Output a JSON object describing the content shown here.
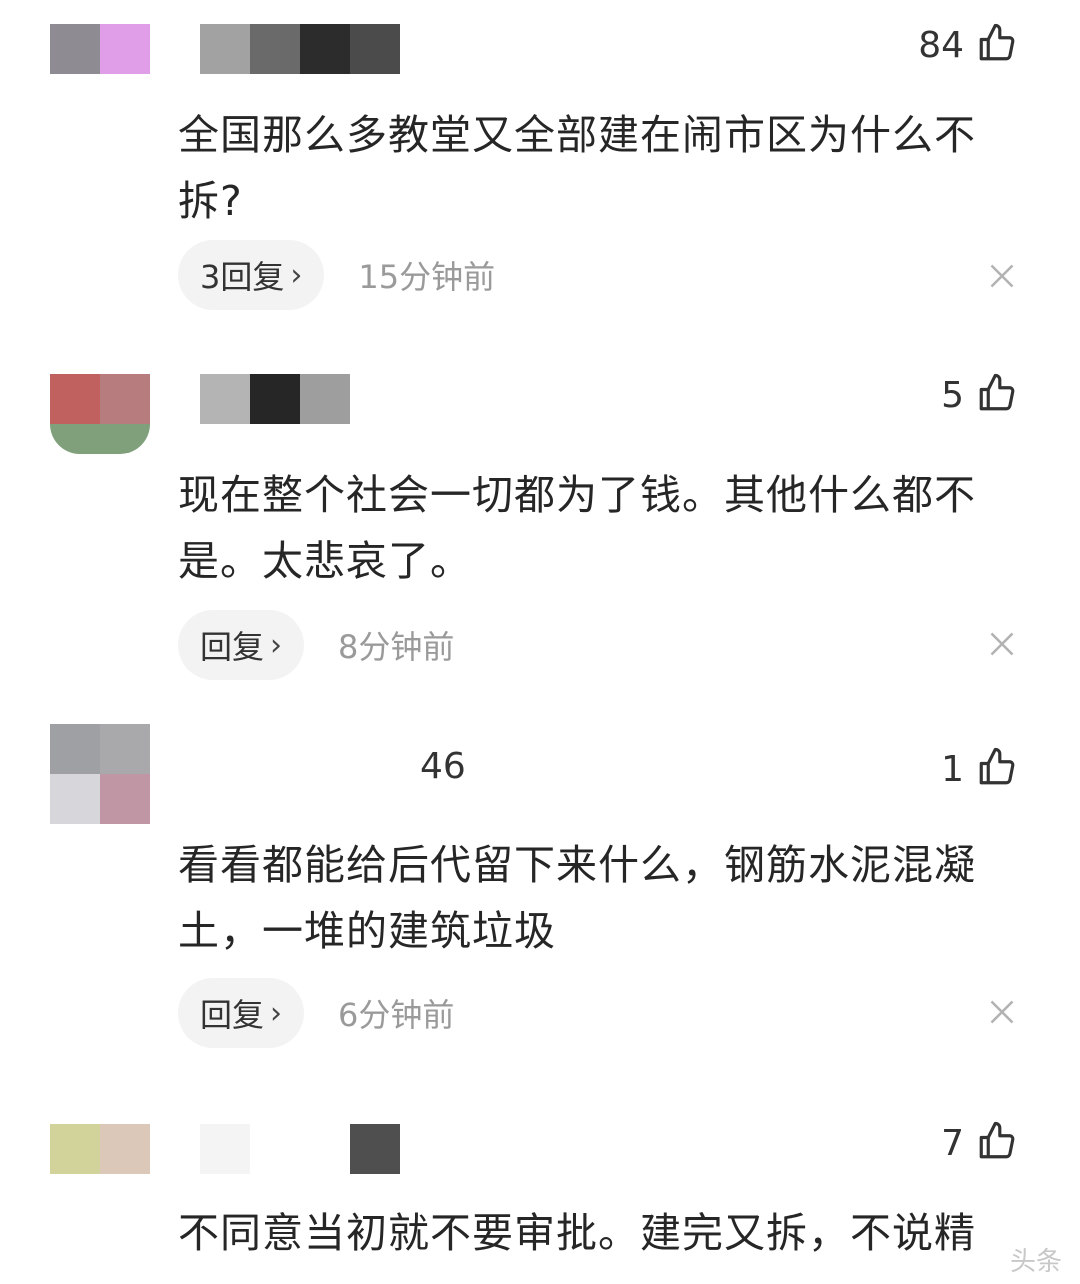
{
  "comments": [
    {
      "likes": "84",
      "text": "全国那么多教堂又全部建在闹市区为什么不拆?",
      "reply_label": "3回复",
      "time": "15分钟前",
      "avatar_colors": [
        "#8f8b92",
        "#e09ee9",
        "#ffffff",
        "#ffffff"
      ],
      "name_colors": [
        "#a2a2a2",
        "#6a6a6a",
        "#2c2c2c",
        "#4b4b4b"
      ]
    },
    {
      "likes": "5",
      "text": "现在整个社会一切都为了钱。其他什么都不是。太悲哀了。",
      "reply_label": "回复",
      "time": "8分钟前",
      "avatar_colors": [
        "#c0615f",
        "#b77c7d",
        "#7fa07a",
        "#e6eee6"
      ],
      "name_colors": [
        "#b4b4b4",
        "#262626",
        "#9e9e9e"
      ]
    },
    {
      "likes": "1",
      "name_tail": "46",
      "text": "看看都能给后代留下来什么，钢筋水泥混凝土，一堆的建筑垃圾",
      "reply_label": "回复",
      "time": "6分钟前",
      "avatar_colors": [
        "#9fa0a4",
        "#a9a9ac",
        "#d7d6db",
        "#c096a4"
      ],
      "name_colors": []
    },
    {
      "likes": "7",
      "text": "不同意当初就不要审批。建完又拆，不说精",
      "reply_label": "",
      "time": "",
      "avatar_colors": [
        "#d2d39a",
        "#dbc8b8",
        "#ffffff",
        "#ffffff"
      ],
      "name_colors": [
        "#f4f4f4",
        "#ffffff",
        "#ffffff",
        "#4f4f4f"
      ]
    }
  ],
  "watermark": "头条",
  "icons": {
    "like": "thumbs-up-icon",
    "close": "close-icon",
    "chevron": "chevron-right-icon"
  }
}
